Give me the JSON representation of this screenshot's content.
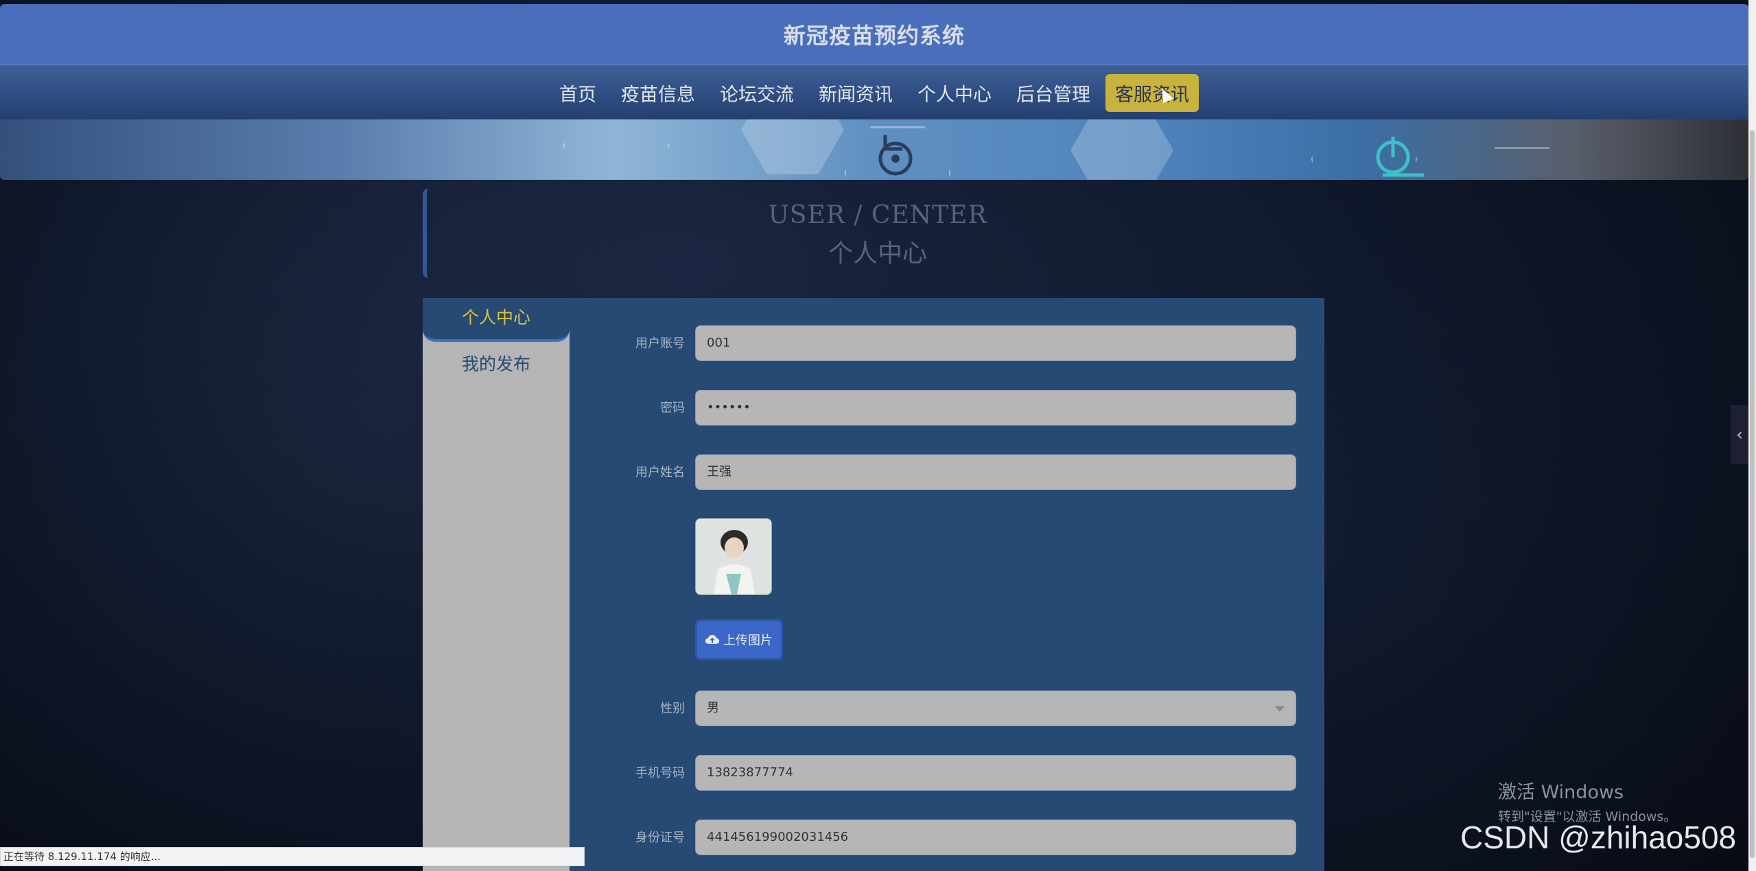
{
  "site_title": "新冠疫苗预约系统",
  "nav": {
    "items": [
      "首页",
      "疫苗信息",
      "论坛交流",
      "新闻资讯",
      "个人中心",
      "后台管理",
      "客服资讯"
    ],
    "active_index": 6
  },
  "section": {
    "title_en": "USER / CENTER",
    "title_zh": "个人中心"
  },
  "side_menu": {
    "items": [
      "个人中心",
      "我的发布"
    ]
  },
  "form": {
    "username_label": "用户账号",
    "username_value": "001",
    "password_label": "密码",
    "password_value": "••••••",
    "realname_label": "用户姓名",
    "realname_value": "王强",
    "upload_label": "上传图片",
    "gender_label": "性别",
    "gender_value": "男",
    "phone_label": "手机号码",
    "phone_value": "13823877774",
    "idcard_label": "身份证号",
    "idcard_value": "441456199002031456"
  },
  "status_text": "正在等待 8.129.11.174 的响应...",
  "windows_activation": {
    "line1": "激活 Windows",
    "line2": "转到\"设置\"以激活 Windows。"
  },
  "watermark": "CSDN @zhihao508",
  "colors": {
    "title_bar": "#4a6ebb",
    "panel": "#264a73",
    "active_nav": "#c8b43c",
    "upload_button": "#3b67c8"
  }
}
